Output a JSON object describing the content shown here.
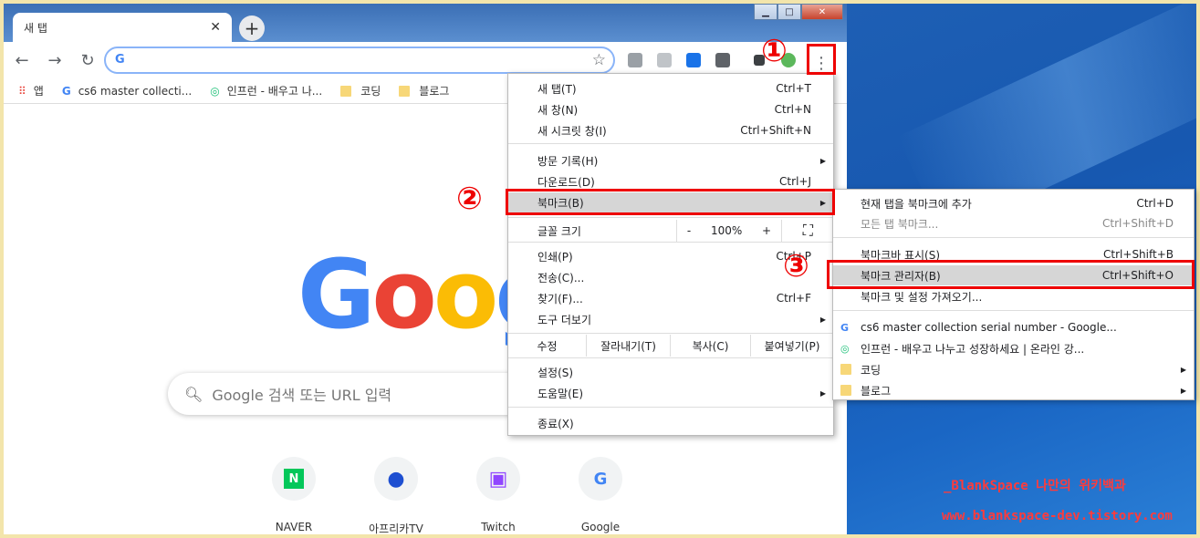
{
  "tab": {
    "title": "새 탭",
    "close": "✕",
    "new": "+"
  },
  "window_controls": {
    "min": "▁",
    "max": "□",
    "close": "✕"
  },
  "toolbar": {
    "back": "←",
    "forward": "→",
    "reload": "↻",
    "omnibox_icon": "G",
    "star": "☆",
    "menu": "⋮"
  },
  "bookmarks_bar": [
    {
      "icon": "apps-icon",
      "label": "앱"
    },
    {
      "icon": "google-icon",
      "label": "cs6 master collecti..."
    },
    {
      "icon": "inflearn-icon",
      "label": "인프런 - 배우고 나..."
    },
    {
      "icon": "folder-icon",
      "label": "코딩"
    },
    {
      "icon": "folder-icon",
      "label": "블로그"
    }
  ],
  "page": {
    "search_placeholder": "Google 검색 또는 URL 입력",
    "shortcuts": [
      {
        "label": "NAVER",
        "glyph": "N",
        "color": "#03c75a"
      },
      {
        "label": "아프리카TV",
        "glyph": "●",
        "color": "#1e4fd1"
      },
      {
        "label": "Twitch",
        "glyph": "▣",
        "color": "#9146ff"
      },
      {
        "label": "Google",
        "glyph": "G",
        "color": "#4285f4"
      }
    ]
  },
  "menu": {
    "new_tab": {
      "label": "새 탭(T)",
      "shortcut": "Ctrl+T"
    },
    "new_window": {
      "label": "새 창(N)",
      "shortcut": "Ctrl+N"
    },
    "incognito": {
      "label": "새 시크릿 창(I)",
      "shortcut": "Ctrl+Shift+N"
    },
    "history": {
      "label": "방문 기록(H)"
    },
    "downloads": {
      "label": "다운로드(D)",
      "shortcut": "Ctrl+J"
    },
    "bookmarks": {
      "label": "북마크(B)"
    },
    "zoom": {
      "label": "글꼴 크기",
      "minus": "-",
      "value": "100%",
      "plus": "+"
    },
    "print": {
      "label": "인쇄(P)",
      "shortcut": "Ctrl+P"
    },
    "cast": {
      "label": "전송(C)..."
    },
    "find": {
      "label": "찾기(F)...",
      "shortcut": "Ctrl+F"
    },
    "more_tools": {
      "label": "도구 더보기"
    },
    "edit": {
      "label": "수정",
      "cut": "잘라내기(T)",
      "copy": "복사(C)",
      "paste": "붙여넣기(P)"
    },
    "settings": {
      "label": "설정(S)"
    },
    "help": {
      "label": "도움말(E)"
    },
    "exit": {
      "label": "종료(X)"
    }
  },
  "submenu": {
    "add_bookmark": {
      "label": "현재 탭을 북마크에 추가",
      "shortcut": "Ctrl+D"
    },
    "bookmark_all": {
      "label": "모든 탭 북마크...",
      "shortcut": "Ctrl+Shift+D"
    },
    "show_bar": {
      "label": "북마크바 표시(S)",
      "shortcut": "Ctrl+Shift+B"
    },
    "manager": {
      "label": "북마크 관리자(B)",
      "shortcut": "Ctrl+Shift+O"
    },
    "import": {
      "label": "북마크 및 설정 가져오기..."
    },
    "item1": {
      "label": "cs6 master collection serial number - Google..."
    },
    "item2": {
      "label": "인프런 - 배우고 나누고 성장하세요 | 온라인 강..."
    },
    "folder1": {
      "label": "코딩"
    },
    "folder2": {
      "label": "블로그"
    }
  },
  "annotations": {
    "n1": "①",
    "n2": "②",
    "n3": "③"
  },
  "watermark": {
    "line1": "_BlankSpace 나만의 위키백과",
    "line2": "www.blankspace-dev.tistory.com"
  },
  "colors": {
    "annotation_red": "#ee0000",
    "google_blue": "#4285f4",
    "google_red": "#ea4335",
    "google_yellow": "#fbbc05",
    "google_green": "#34a853"
  }
}
